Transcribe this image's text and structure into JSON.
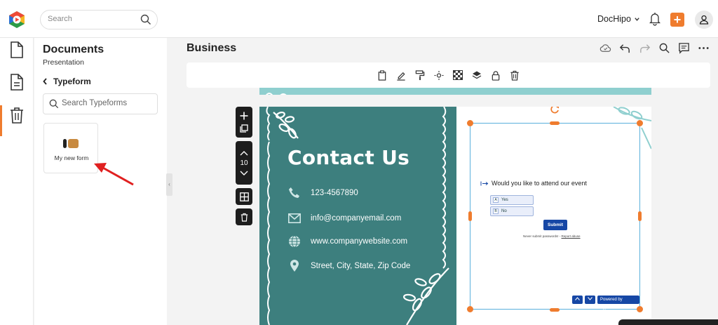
{
  "header": {
    "search_placeholder": "Search",
    "user_name": "DocHipo",
    "colors": {
      "accent": "#ef7c2e",
      "teal": "#3d7f7e"
    }
  },
  "panel": {
    "title": "Documents",
    "subtitle": "Presentation",
    "back_label": "Typeform",
    "search_placeholder": "Search Typeforms",
    "items": [
      {
        "label": "My new form"
      }
    ]
  },
  "editor": {
    "title": "Business",
    "page_number": "10"
  },
  "slide": {
    "heading": "Contact Us",
    "phone": "123-4567890",
    "email": "info@companyemail.com",
    "website": "www.companywebsite.com",
    "address": "Street, City, State, Zip Code"
  },
  "typeform": {
    "question": "Would you like to attend our event",
    "options": [
      {
        "key": "A",
        "label": "Yes"
      },
      {
        "key": "B",
        "label": "No"
      }
    ],
    "submit_label": "Submit",
    "footer_text": "Never submit passwords! - ",
    "report_link": "Report abuse",
    "powered_by": "Powered by Typeform"
  }
}
